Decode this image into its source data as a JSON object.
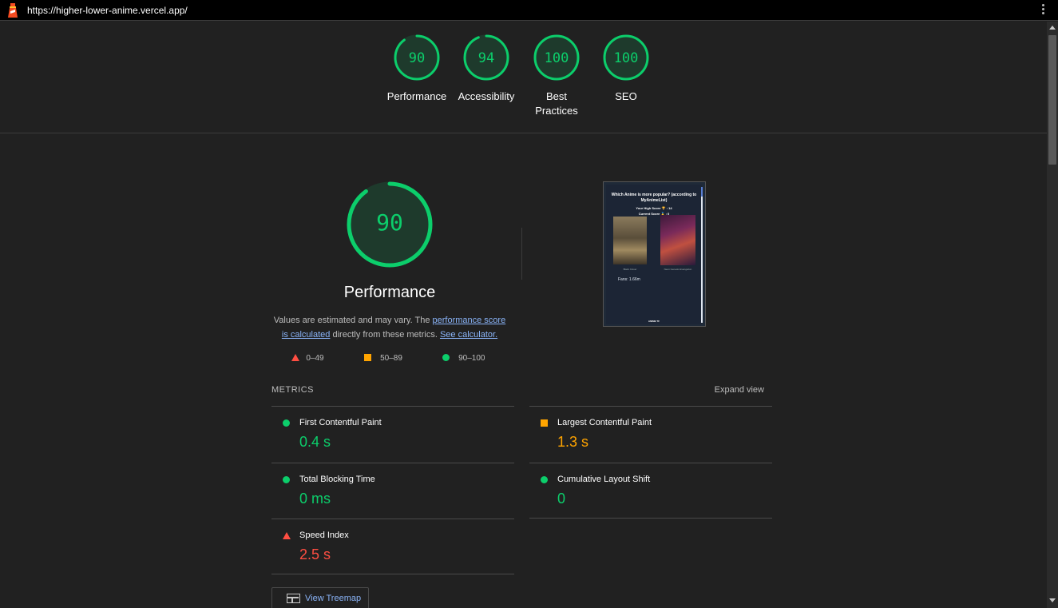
{
  "browser": {
    "url": "https://higher-lower-anime.vercel.app/"
  },
  "summary": [
    {
      "score": "90",
      "label": "Performance",
      "fraction": 0.9
    },
    {
      "score": "94",
      "label": "Accessibility",
      "fraction": 0.94
    },
    {
      "score": "100",
      "label": "Best Practices",
      "fraction": 1.0
    },
    {
      "score": "100",
      "label": "SEO",
      "fraction": 1.0
    }
  ],
  "performance": {
    "score": "90",
    "fraction": 0.9,
    "title": "Performance",
    "desc_prefix": "Values are estimated and may vary. The ",
    "link_score": "performance score is calculated",
    "desc_mid": " directly from these metrics. ",
    "link_calc": "See calculator."
  },
  "legend": {
    "fail": "0–49",
    "average": "50–89",
    "pass": "90–100"
  },
  "screenshot": {
    "heading": "Which Anime is more popular? (according to MyAnimeList)",
    "high_score": "Your High Score 🏆 : 14",
    "current_score": "Current Score 🥇 : 0",
    "caption_left": "Black Clover",
    "caption_right": "Neon Genesis Evangelion",
    "fans": "Fans: 1.66m",
    "footer": "ANIME TF"
  },
  "metrics": {
    "label": "METRICS",
    "expand": "Expand view",
    "items": [
      {
        "name": "First Contentful Paint",
        "value": "0.4 s",
        "status": "pass"
      },
      {
        "name": "Largest Contentful Paint",
        "value": "1.3 s",
        "status": "average"
      },
      {
        "name": "Total Blocking Time",
        "value": "0 ms",
        "status": "pass"
      },
      {
        "name": "Cumulative Layout Shift",
        "value": "0",
        "status": "pass"
      },
      {
        "name": "Speed Index",
        "value": "2.5 s",
        "status": "fail"
      }
    ]
  },
  "treemap": {
    "label": "View Treemap"
  },
  "colors": {
    "pass": "#0cce6b",
    "average": "#ffa400",
    "fail": "#ff4e42",
    "link": "#8ab4f8"
  }
}
